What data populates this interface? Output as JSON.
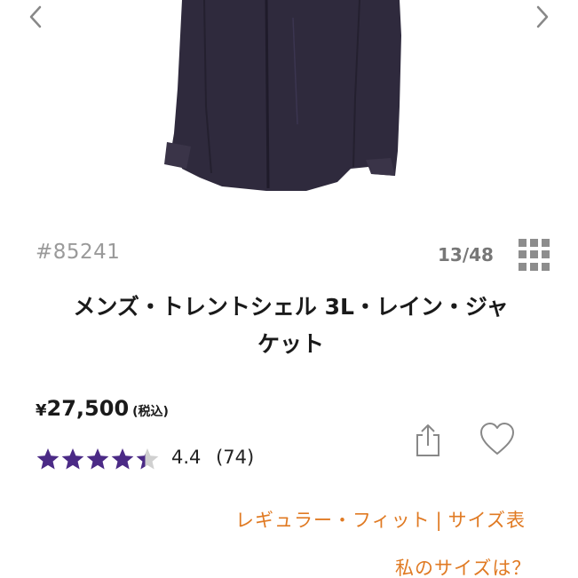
{
  "navigation": {
    "prev_icon": "chevron-left-icon",
    "next_icon": "chevron-right-icon"
  },
  "product": {
    "sku": "#85241",
    "image_counter": "13/48",
    "title_line1": "メンズ・トレントシェル 3L・レイン・ジャ",
    "title_line2": "ケット",
    "price_symbol": "¥",
    "price_value": "27,500",
    "price_tax_note": "(税込)",
    "rating_value": 4.4,
    "rating_text": "4.4",
    "review_count": "(74)",
    "star_color": "#4b2a86",
    "star_empty_color": "#d0d0d0",
    "jacket_color": "#2f2a3d"
  },
  "actions": {
    "share_icon": "share-icon",
    "favorite_icon": "heart-icon",
    "gallery_icon": "grid-icon"
  },
  "links": {
    "fit_label": "レギュラー・フィット",
    "separator": "|",
    "size_chart_label": "サイズ表",
    "my_size_label": "私のサイズは？",
    "link_color": "#e07a23"
  }
}
